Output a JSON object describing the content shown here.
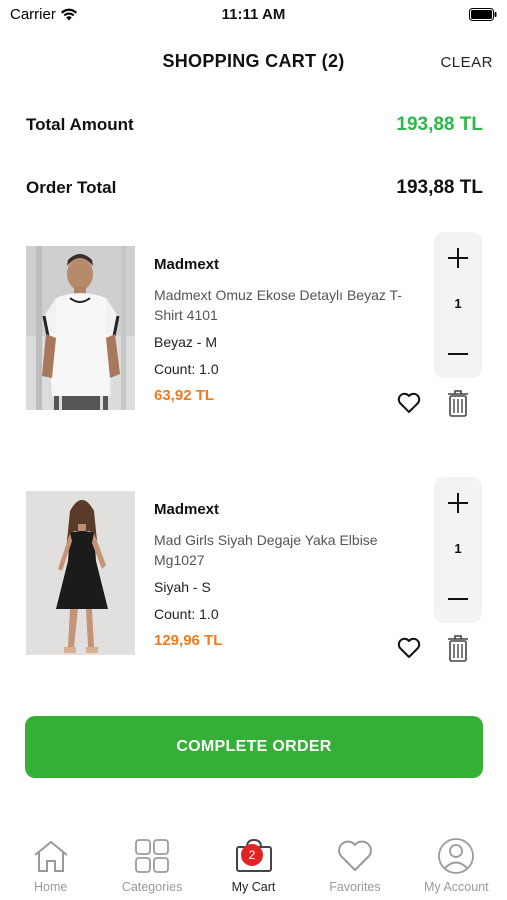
{
  "status_bar": {
    "carrier": "Carrier",
    "time": "11:11 AM"
  },
  "header": {
    "title": "SHOPPING CART (2)",
    "clear_label": "CLEAR"
  },
  "summary": {
    "total_amount_label": "Total Amount",
    "total_amount_value": "193,88 TL",
    "order_total_label": "Order Total",
    "order_total_value": "193,88 TL"
  },
  "items": [
    {
      "brand": "Madmext",
      "name": "Madmext Omuz Ekose Detaylı Beyaz T-Shirt 4101",
      "variant": "Beyaz - M",
      "count": "Count:  1.0",
      "price": "63,92 TL",
      "quantity": "1"
    },
    {
      "brand": "Madmext",
      "name": "Mad Girls Siyah Degaje Yaka Elbise Mg1027",
      "variant": "Siyah - S",
      "count": "Count:  1.0",
      "price": "129,96 TL",
      "quantity": "1"
    }
  ],
  "complete_order_label": "COMPLETE ORDER",
  "tabs": [
    {
      "label": "Home",
      "icon": "home-icon",
      "active": false
    },
    {
      "label": "Categories",
      "icon": "grid-icon",
      "active": false
    },
    {
      "label": "My Cart",
      "icon": "cart-icon",
      "active": true,
      "badge": "2"
    },
    {
      "label": "Favorites",
      "icon": "heart-icon",
      "active": false
    },
    {
      "label": "My Account",
      "icon": "user-icon",
      "active": false
    }
  ],
  "colors": {
    "accent_green": "#33b035",
    "price_green": "#2bb84a",
    "price_orange": "#f07a1c",
    "badge_red": "#e02424"
  }
}
